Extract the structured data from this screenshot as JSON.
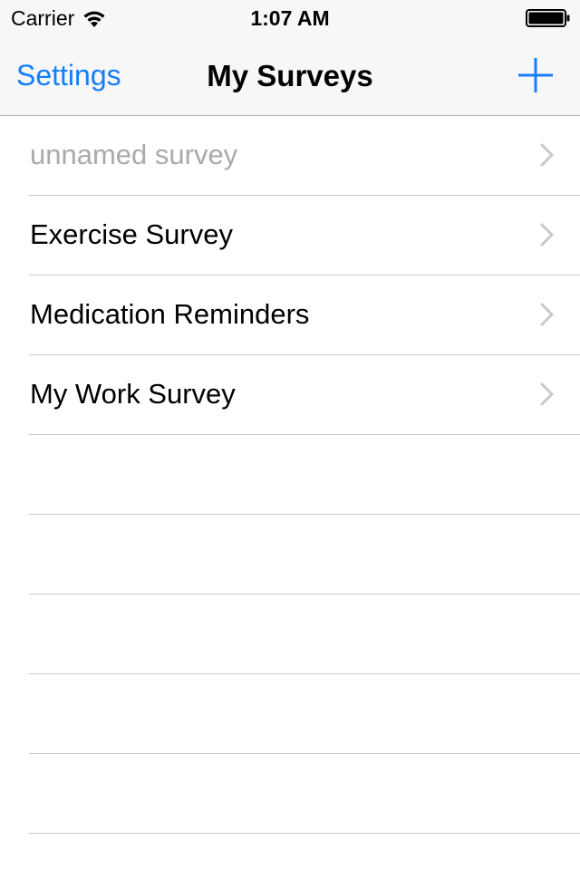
{
  "status_bar": {
    "carrier": "Carrier",
    "time": "1:07 AM",
    "wifi_icon": "wifi-icon",
    "battery_icon": "battery-icon"
  },
  "nav": {
    "left_label": "Settings",
    "title": "My Surveys",
    "add_icon": "plus-icon",
    "accent_color": "#147efb"
  },
  "surveys": [
    {
      "label": "unnamed survey",
      "placeholder": true
    },
    {
      "label": "Exercise Survey",
      "placeholder": false
    },
    {
      "label": "Medication Reminders",
      "placeholder": false
    },
    {
      "label": "My Work Survey",
      "placeholder": false
    }
  ],
  "colors": {
    "placeholder_text": "#aaaaaa",
    "separator": "#c8c7cc",
    "chevron": "#c7c7cc",
    "nav_background": "#f7f7f8"
  }
}
